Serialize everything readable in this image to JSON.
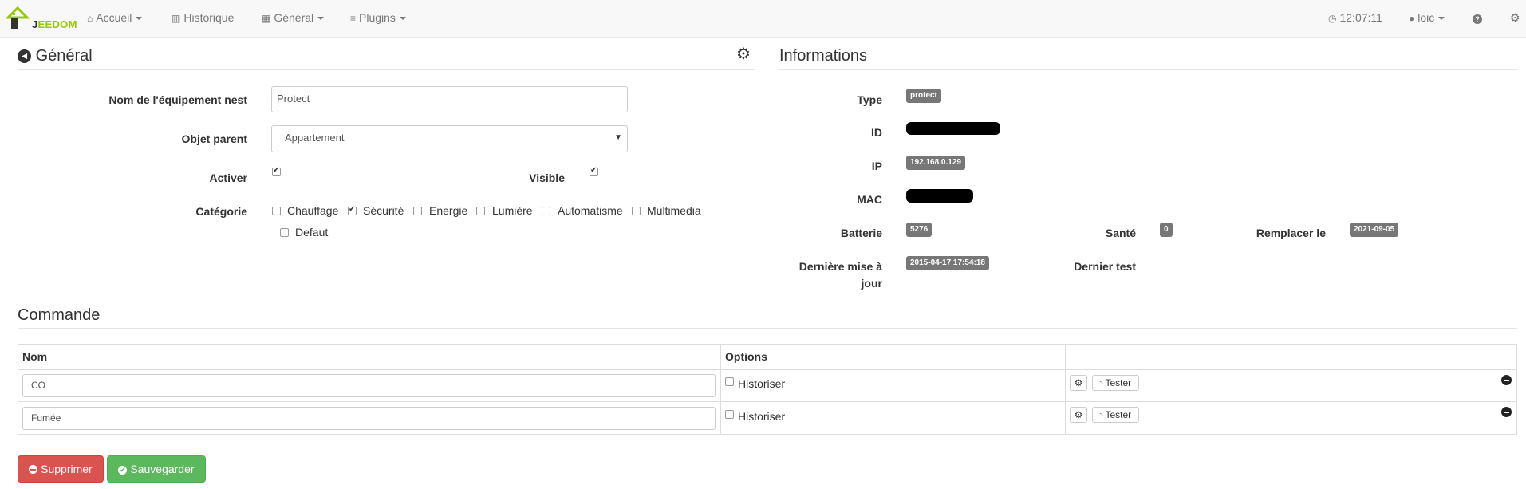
{
  "navbar": {
    "logo_j": "J",
    "logo_rest": "EEDOM",
    "menu": [
      {
        "label": "Accueil",
        "icon": "home-icon"
      },
      {
        "label": "Historique",
        "icon": "bar-chart-icon"
      },
      {
        "label": "Général",
        "icon": "grid-icon"
      },
      {
        "label": "Plugins",
        "icon": "list-icon"
      }
    ],
    "time": "12:07:11",
    "user": "loic",
    "help_icon": "question-icon"
  },
  "general": {
    "title": "Général",
    "fields": {
      "name_label": "Nom de l'équipement nest",
      "name_value": "Protect",
      "parent_label": "Objet parent",
      "parent_value": "Appartement",
      "activer_label": "Activer",
      "visible_label": "Visible",
      "categorie_label": "Catégorie"
    },
    "categories": [
      {
        "label": "Chauffage",
        "checked": false
      },
      {
        "label": "Sécurité",
        "checked": true
      },
      {
        "label": "Energie",
        "checked": false
      },
      {
        "label": "Lumière",
        "checked": false
      },
      {
        "label": "Automatisme",
        "checked": false
      },
      {
        "label": "Multimedia",
        "checked": false
      },
      {
        "label": "Defaut",
        "checked": false
      }
    ]
  },
  "informations": {
    "title": "Informations",
    "type_label": "Type",
    "type_value": "protect",
    "id_label": "ID",
    "ip_label": "IP",
    "ip_value": "192.168.0.129",
    "mac_label": "MAC",
    "batterie_label": "Batterie",
    "batterie_value": "5276",
    "sante_label": "Santé",
    "sante_value": "0",
    "remplacer_label": "Remplacer le",
    "remplacer_value": "2021-09-05",
    "maj_label_1": "Dernière mise à",
    "maj_label_2": "jour",
    "maj_value": "2015-04-17 17:54:18",
    "test_label": "Dernier test"
  },
  "commande": {
    "title": "Commande",
    "headers": [
      "Nom",
      "Options",
      ""
    ],
    "rows": [
      {
        "name": "CO",
        "option": "Historiser",
        "test": "Tester"
      },
      {
        "name": "Fumée",
        "option": "Historiser",
        "test": "Tester"
      }
    ]
  },
  "actions": {
    "delete": "Supprimer",
    "save": "Sauvegarder"
  },
  "colors": {
    "accent": "#94ca02",
    "danger": "#d9534f",
    "success": "#5cb85c",
    "badge": "#777777"
  }
}
